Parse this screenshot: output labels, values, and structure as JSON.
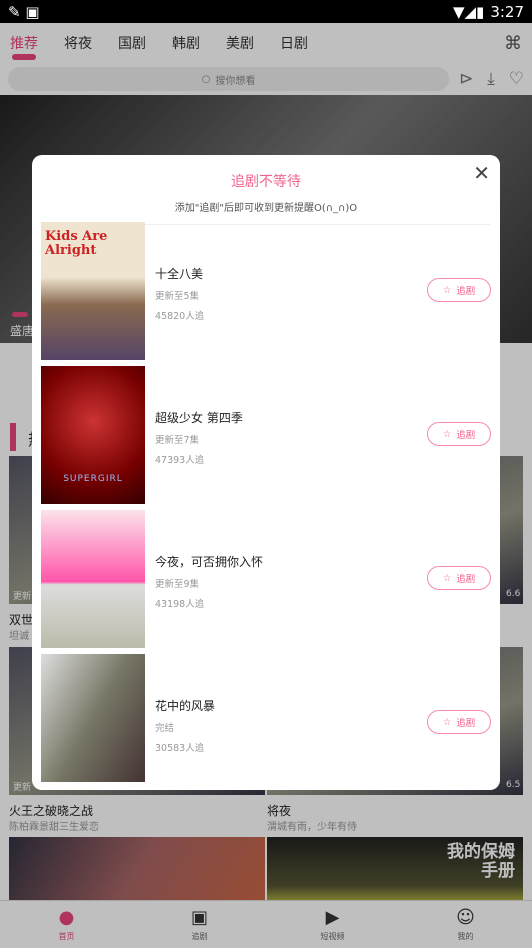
{
  "status": {
    "time": "3:27"
  },
  "topnav": {
    "tabs": [
      "推荐",
      "将夜",
      "国剧",
      "韩剧",
      "美剧",
      "日剧"
    ],
    "active": 0
  },
  "search": {
    "placeholder": "搜你想看"
  },
  "background": {
    "banner_caption": "盛唐",
    "section_title": "热",
    "cards": [
      {
        "title": "双世",
        "subtitle": "坦诚",
        "overlay": "更新",
        "score": "6.6"
      },
      {
        "title": "",
        "subtitle": "",
        "overlay": "更新",
        "score": "6.5"
      },
      {
        "title": "火王之破晓之战",
        "subtitle": "陈柏霖景甜三生爱恋"
      },
      {
        "title": "将夜",
        "subtitle": "渭城有雨，少年有侍"
      },
      {
        "poster_text": "我的保姆手册"
      }
    ]
  },
  "modal": {
    "title": "追剧不等待",
    "subtitle": "添加\"追剧\"后即可收到更新提醒O(∩_∩)O",
    "follow_label": "追剧",
    "items": [
      {
        "name": "十全八美",
        "update": "更新至5集",
        "count": "45820人追",
        "poster_text": "Kids Are Alright"
      },
      {
        "name": "超级少女 第四季",
        "update": "更新至7集",
        "count": "47393人追",
        "poster_text": "SUPERGIRL"
      },
      {
        "name": "今夜，可否拥你入怀",
        "update": "更新至9集",
        "count": "43198人追"
      },
      {
        "name": "花中的风暴",
        "update": "完结",
        "count": "30583人追"
      }
    ]
  },
  "tabbar": {
    "items": [
      "首页",
      "追剧",
      "短视频",
      "我的"
    ],
    "active": 0
  },
  "colors": {
    "accent": "#e8467c",
    "modal_title": "#f0648c"
  }
}
